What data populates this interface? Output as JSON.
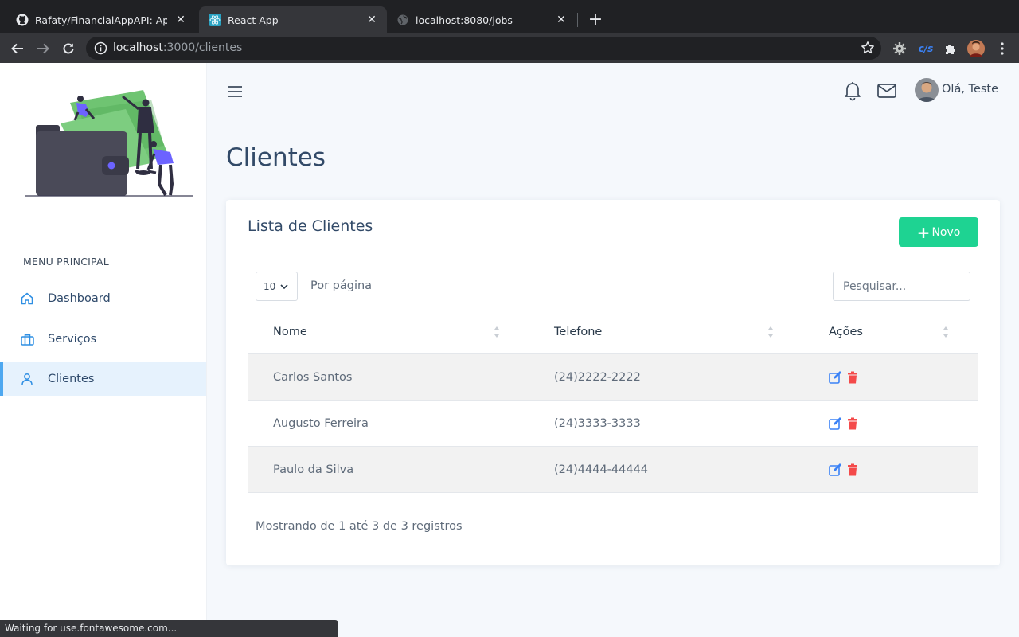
{
  "browser": {
    "tabs": [
      {
        "title": "Rafaty/FinancialAppAPI: Api do",
        "icon": "github-icon"
      },
      {
        "title": "React App",
        "icon": "react-icon"
      },
      {
        "title": "localhost:8080/jobs",
        "icon": "globe-icon"
      }
    ],
    "url_host": "localhost",
    "url_path": ":3000/clientes",
    "status_text": "Waiting for use.fontawesome.com..."
  },
  "sidebar": {
    "menu_heading": "MENU PRINCIPAL",
    "items": [
      {
        "label": "Dashboard",
        "icon": "home-icon"
      },
      {
        "label": "Serviços",
        "icon": "briefcase-icon"
      },
      {
        "label": "Clientes",
        "icon": "user-icon"
      }
    ]
  },
  "header": {
    "greeting": "Olá, Teste"
  },
  "page": {
    "title": "Clientes"
  },
  "card": {
    "title": "Lista de Clientes",
    "new_button": "Novo",
    "per_page_value": "10",
    "per_page_label": "Por página",
    "search_placeholder": "Pesquisar...",
    "columns": [
      "Nome",
      "Telefone",
      "Ações"
    ],
    "rows": [
      {
        "nome": "Carlos Santos",
        "telefone": "(24)2222-2222"
      },
      {
        "nome": "Augusto Ferreira",
        "telefone": "(24)3333-3333"
      },
      {
        "nome": "Paulo da Silva",
        "telefone": "(24)4444-44444"
      }
    ],
    "footer": "Mostrando de 1 até 3 de 3 registros"
  },
  "colors": {
    "accent_green": "#1ed392",
    "edit_blue": "#3b82f6",
    "delete_red": "#f44a4a",
    "active_menu_bg": "#e6f2fd"
  }
}
